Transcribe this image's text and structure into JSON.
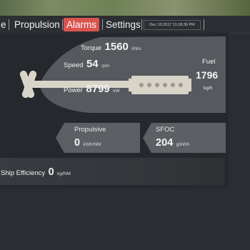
{
  "nav": {
    "items": [
      "e",
      "Propulsion",
      "Alarms",
      "Settings"
    ],
    "active": "Alarms",
    "datetime": "Dec 10.2017 11:18:36 PM"
  },
  "engine": {
    "torque": {
      "label": "Torque",
      "value": "1560",
      "unit": "kNm"
    },
    "speed": {
      "label": "Speed",
      "value": "54",
      "unit": "rpm"
    },
    "power": {
      "label": "Power",
      "value": "8799",
      "unit": "kW"
    },
    "fuel": {
      "label": "Fuel",
      "value": "1796",
      "unit": "kg/h"
    }
  },
  "kpis": {
    "propulsive": {
      "label": "Propulsive",
      "value": "0",
      "unit": "kWh/NM"
    },
    "sfoc": {
      "label": "SFOC",
      "value": "204",
      "unit": "g/kWh"
    }
  },
  "ship_efficiency": {
    "label": "Ship Efficiency",
    "value": "0",
    "unit": "kg/NM"
  },
  "colors": {
    "alarm_active": "#d9534f",
    "hull": "#56595e",
    "machinery": "#d8d4c8",
    "kpi_box": "#5c5f64"
  }
}
